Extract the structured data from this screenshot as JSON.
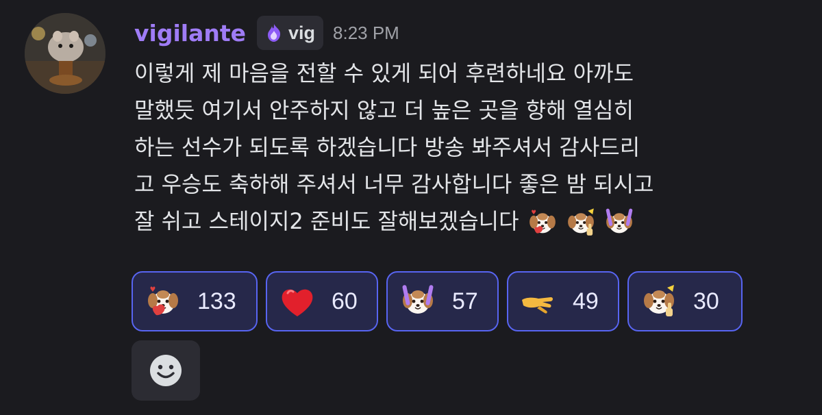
{
  "message": {
    "author": "vigilante",
    "tag": {
      "icon": "purple-flame-icon",
      "text": "vig"
    },
    "timestamp": "8:23 PM",
    "lines": [
      "이렇게 제 마음을 전할 수 있게 되어 후련하네요 아까도",
      "말했듯 여기서 안주하지 않고 더 높은 곳을 향해 열심히",
      "하는 선수가 되도록 하겠습니다 방송 봐주셔서 감사드리",
      "고 우승도 축하해 주셔서 너무 감사합니다 좋은 밤 되시고",
      "잘 쉬고 스테이지2 준비도 잘해보겠습니다"
    ],
    "inline_emojis": [
      "puppy-heart-emoji",
      "puppy-thumbsup-emoji",
      "puppy-lightsticks-emoji"
    ]
  },
  "reactions": [
    {
      "emoji": "puppy-heart-emoji",
      "count": "133"
    },
    {
      "emoji": "red-heart-emoji",
      "count": "60"
    },
    {
      "emoji": "puppy-lightsticks-emoji",
      "count": "57"
    },
    {
      "emoji": "pinching-hand-emoji",
      "count": "49"
    },
    {
      "emoji": "puppy-thumbsup-emoji",
      "count": "30"
    }
  ],
  "add_reaction": {
    "icon": "smiley-face-icon"
  },
  "colors": {
    "background": "#1b1b1f",
    "username": "#9f7cf6",
    "reaction_border": "#5865f2",
    "reaction_bg": "#26284a"
  }
}
